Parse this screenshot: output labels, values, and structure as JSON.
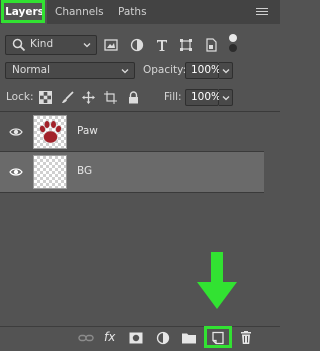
{
  "tabs": [
    "Layers",
    "Channels",
    "Paths"
  ],
  "filter": {
    "kind_label": "Kind"
  },
  "blend": {
    "mode": "Normal",
    "opacity_label": "Opacity:",
    "opacity_value": "100%"
  },
  "lock": {
    "label": "Lock:",
    "fill_label": "Fill:",
    "fill_value": "100%"
  },
  "layers": [
    {
      "name": "Paw",
      "visible": true,
      "selected": false
    },
    {
      "name": "BG",
      "visible": true,
      "selected": true
    }
  ],
  "highlight_color": "#32e232",
  "bottom_icons": [
    "link-layers-icon",
    "fx-icon",
    "add-mask-icon",
    "adjustment-layer-icon",
    "new-group-icon",
    "new-layer-icon",
    "delete-layer-icon"
  ],
  "bottom_fx_label": "fx"
}
